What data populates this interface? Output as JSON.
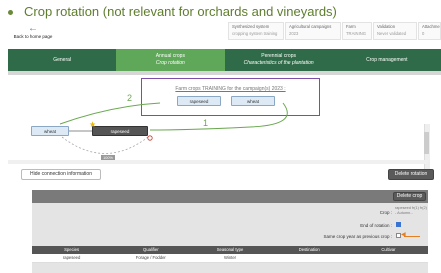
{
  "header": {
    "title": "Crop rotation (not relevant for orchards and vineyards)",
    "back_label": "Back to home page",
    "info": [
      {
        "key": "Synthesized system",
        "value": "cropping system training"
      },
      {
        "key": "Agricultural campaigns",
        "value": "2023"
      },
      {
        "key": "Farm",
        "value": "TRAINING"
      },
      {
        "key": "Validation",
        "value": "Never validated"
      },
      {
        "key": "Attachments",
        "value": "0"
      }
    ]
  },
  "tabs": [
    {
      "label": "General",
      "sub": ""
    },
    {
      "label": "Annual crops",
      "sub": "Crop rotation"
    },
    {
      "label": "Perennial crops",
      "sub": "Characteristics of the plantation"
    },
    {
      "label": "Crop management",
      "sub": ""
    }
  ],
  "diagram": {
    "fc_title": "Farm crops TRAINING for the campaign(s) 2023 :",
    "farm_crops": [
      "rapeseed",
      "wheat"
    ],
    "rotation_nodes": [
      "wheat",
      "rapeseed"
    ],
    "flow_labels": [
      "2",
      "1"
    ],
    "badge": "100%",
    "colors": {
      "flow": "#6aa84f",
      "frame": "#7e4da8"
    }
  },
  "buttons": {
    "hide_connection": "Hide connection information",
    "delete_rotation": "Delete rotation",
    "delete_crop": "Delete crop"
  },
  "crop_panel": {
    "crop_label": "Crop :",
    "crop_value": "rapeseed fr(1) fr(2) - Autumn...",
    "end_of_rotation_label": "End of rotation :",
    "same_year_label": "Same crop year as previous crop :"
  },
  "table": {
    "headers": [
      "Species",
      "Qualifier",
      "Seasonal type",
      "Destination",
      "Cultivar"
    ],
    "rows": [
      [
        "rapeseed",
        "Forage / Fodder",
        "Winter",
        "",
        ""
      ]
    ]
  }
}
